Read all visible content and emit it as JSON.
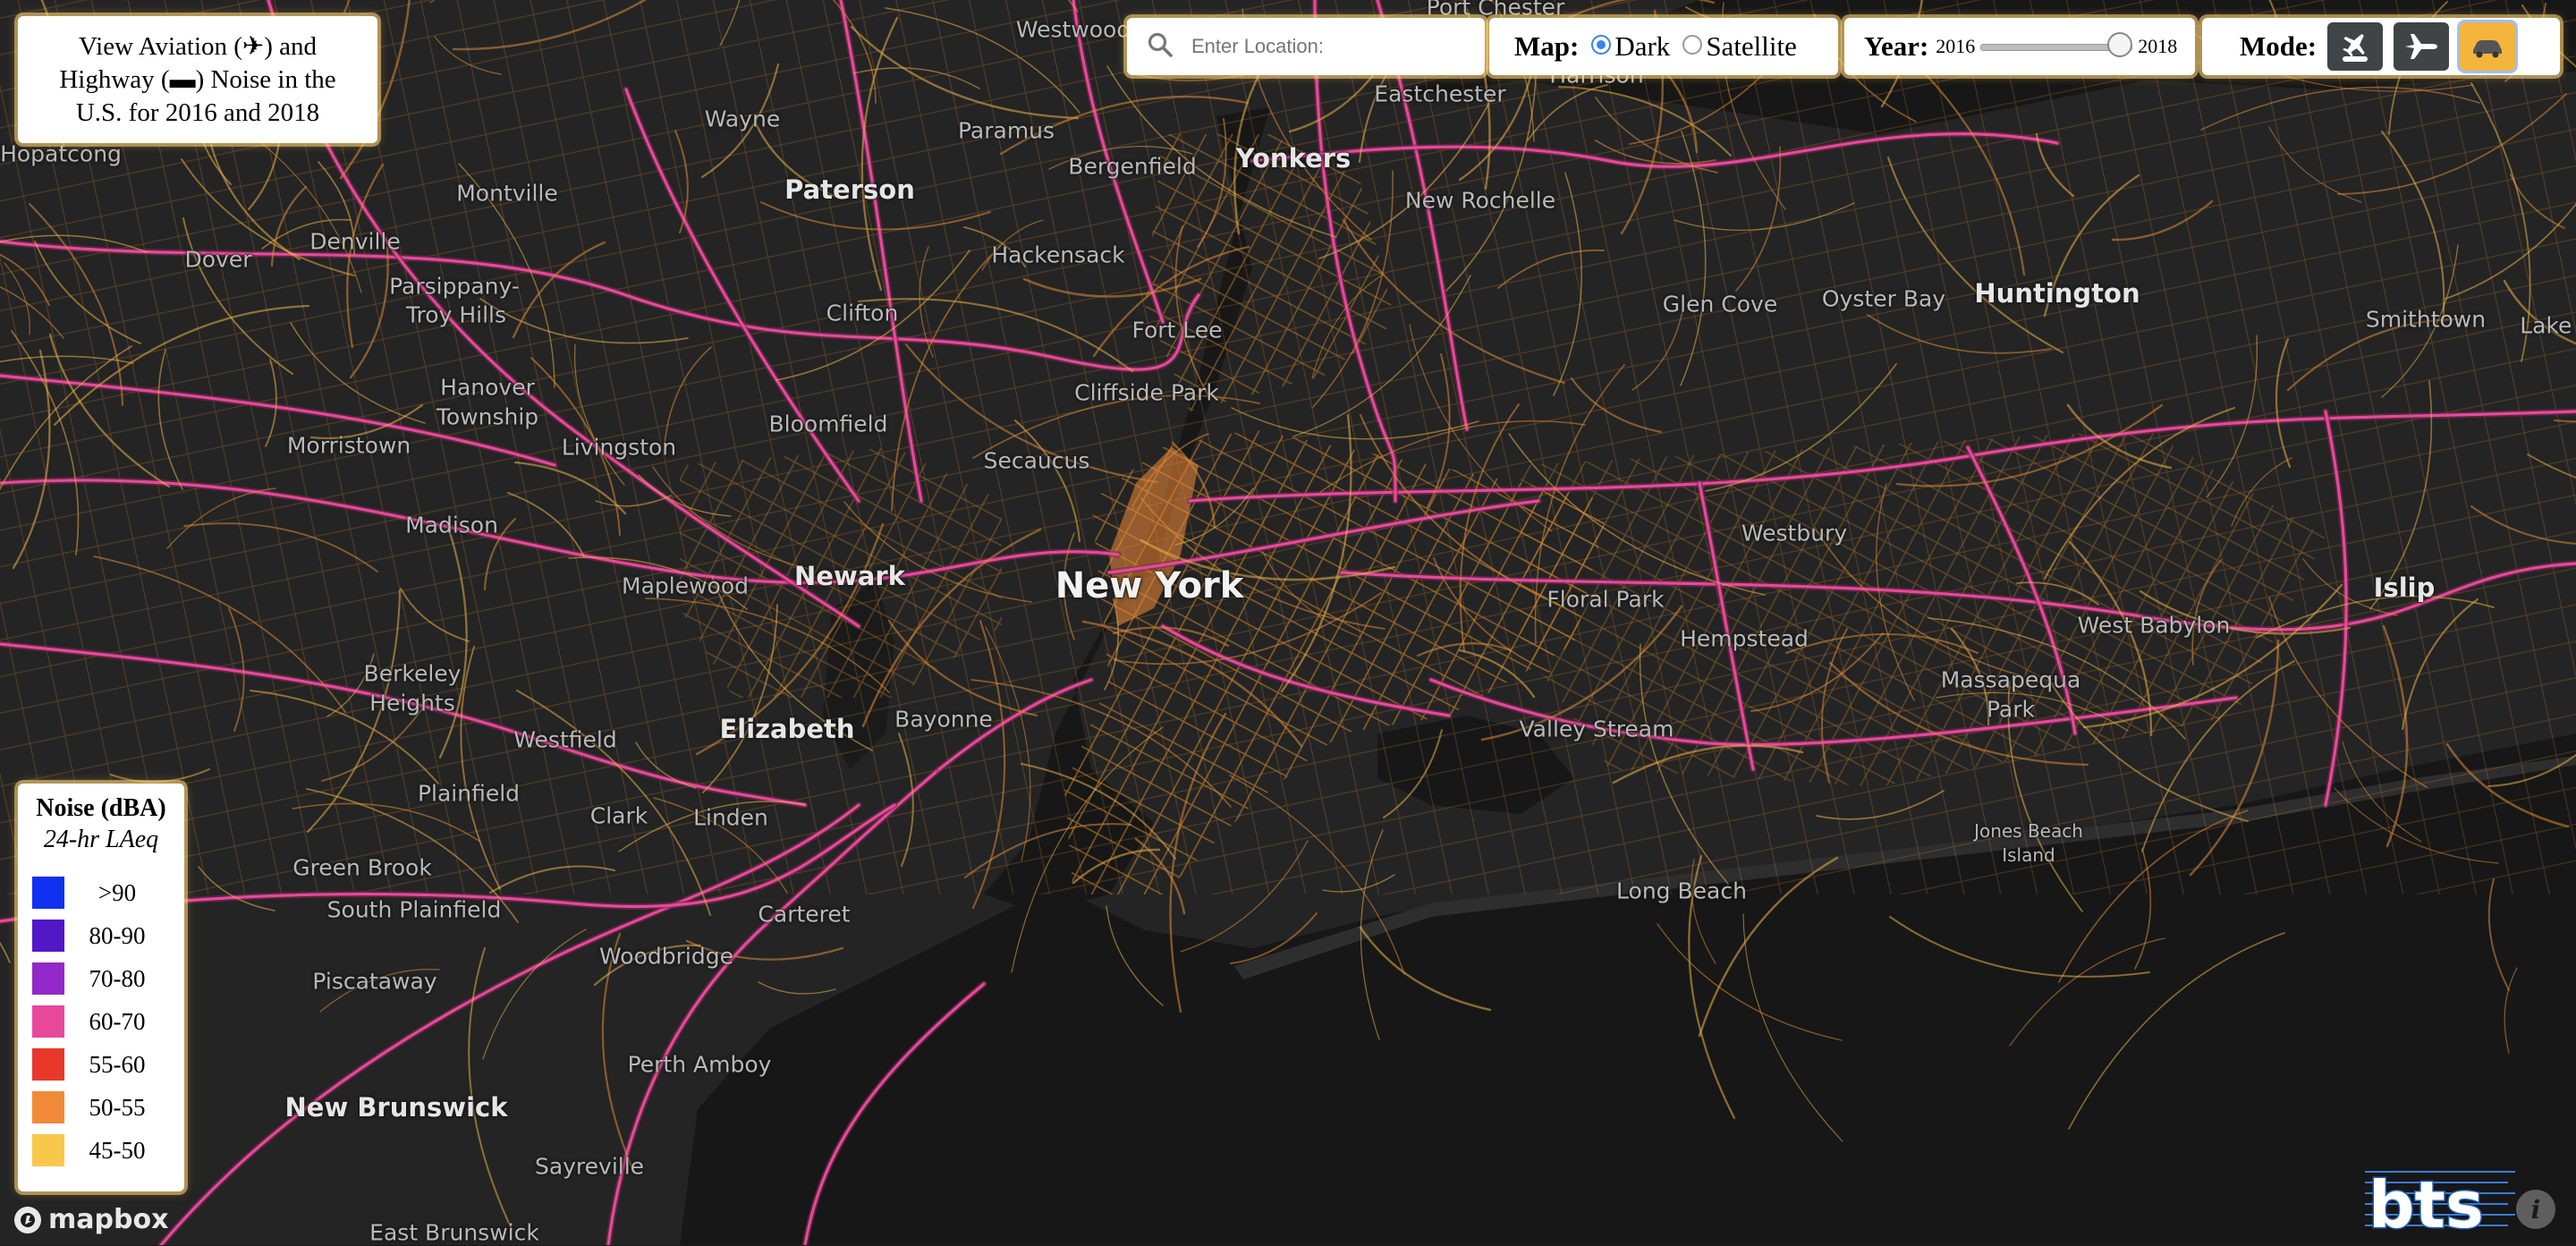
{
  "title": {
    "line1": "View Aviation (✈) and",
    "line2": "Highway (▬) Noise in the",
    "line3": "U.S. for 2016 and 2018"
  },
  "search": {
    "placeholder": "Enter Location:"
  },
  "map_toggle": {
    "label": "Map:",
    "options": [
      {
        "label": "Dark",
        "selected": true
      },
      {
        "label": "Satellite",
        "selected": false
      }
    ]
  },
  "year": {
    "label": "Year:",
    "min": "2016",
    "max": "2018",
    "value": 2018
  },
  "mode": {
    "label": "Mode:",
    "buttons": [
      {
        "icon": "plane-car-icon",
        "active": false
      },
      {
        "icon": "airplane-icon",
        "active": false
      },
      {
        "icon": "car-icon",
        "active": true
      }
    ]
  },
  "legend": {
    "title": "Noise (dBA)",
    "subtitle": "24-hr LAeq",
    "items": [
      {
        "label": ">90",
        "color": "#1030f0"
      },
      {
        "label": "80-90",
        "color": "#5218c8"
      },
      {
        "label": "70-80",
        "color": "#9228c8"
      },
      {
        "label": "60-70",
        "color": "#e8489a"
      },
      {
        "label": "55-60",
        "color": "#e8382a"
      },
      {
        "label": "50-55",
        "color": "#f08a38"
      },
      {
        "label": "45-50",
        "color": "#f8c84a"
      }
    ]
  },
  "places": [
    {
      "name": "Hopatcong",
      "type": "town"
    },
    {
      "name": "Westwood",
      "type": "town"
    },
    {
      "name": "Port Chester",
      "type": "town"
    },
    {
      "name": "Eastchester",
      "type": "town"
    },
    {
      "name": "Harrison",
      "type": "town"
    },
    {
      "name": "Wayne",
      "type": "town"
    },
    {
      "name": "Paramus",
      "type": "town"
    },
    {
      "name": "Bergenfield",
      "type": "town"
    },
    {
      "name": "Yonkers",
      "type": "city"
    },
    {
      "name": "Paterson",
      "type": "city"
    },
    {
      "name": "Montville",
      "type": "town"
    },
    {
      "name": "New Rochelle",
      "type": "town"
    },
    {
      "name": "Dover",
      "type": "town"
    },
    {
      "name": "Denville",
      "type": "town"
    },
    {
      "name": "Hackensack",
      "type": "town"
    },
    {
      "name": "Parsippany-",
      "type": "town"
    },
    {
      "name": "Troy Hills",
      "type": "town"
    },
    {
      "name": "Clifton",
      "type": "town"
    },
    {
      "name": "Glen Cove",
      "type": "town"
    },
    {
      "name": "Oyster Bay",
      "type": "town"
    },
    {
      "name": "Huntington",
      "type": "city"
    },
    {
      "name": "Smithtown",
      "type": "town"
    },
    {
      "name": "Lake G",
      "type": "town"
    },
    {
      "name": "Fort Lee",
      "type": "town"
    },
    {
      "name": "Cliffside Park",
      "type": "town"
    },
    {
      "name": "Hanover",
      "type": "town"
    },
    {
      "name": "Township",
      "type": "town"
    },
    {
      "name": "Bloomfield",
      "type": "town"
    },
    {
      "name": "Morristown",
      "type": "town"
    },
    {
      "name": "Livingston",
      "type": "town"
    },
    {
      "name": "Secaucus",
      "type": "town"
    },
    {
      "name": "Madison",
      "type": "town"
    },
    {
      "name": "Westbury",
      "type": "town"
    },
    {
      "name": "Newark",
      "type": "city"
    },
    {
      "name": "New York",
      "type": "major"
    },
    {
      "name": "Maplewood",
      "type": "town"
    },
    {
      "name": "Floral Park",
      "type": "town"
    },
    {
      "name": "Islip",
      "type": "city"
    },
    {
      "name": "Hempstead",
      "type": "town"
    },
    {
      "name": "West Babylon",
      "type": "town"
    },
    {
      "name": "Berkeley",
      "type": "town"
    },
    {
      "name": "Heights",
      "type": "town"
    },
    {
      "name": "Massapequa",
      "type": "town"
    },
    {
      "name": "Park",
      "type": "town"
    },
    {
      "name": "Bayonne",
      "type": "town"
    },
    {
      "name": "Elizabeth",
      "type": "city"
    },
    {
      "name": "Westfield",
      "type": "town"
    },
    {
      "name": "Valley Stream",
      "type": "town"
    },
    {
      "name": "Plainfield",
      "type": "town"
    },
    {
      "name": "Clark",
      "type": "town"
    },
    {
      "name": "Linden",
      "type": "town"
    },
    {
      "name": "Jones Beach",
      "type": "small"
    },
    {
      "name": "Island",
      "type": "small"
    },
    {
      "name": "Green Brook",
      "type": "town"
    },
    {
      "name": "Long Beach",
      "type": "town"
    },
    {
      "name": "Carteret",
      "type": "town"
    },
    {
      "name": "South Plainfield",
      "type": "town"
    },
    {
      "name": "Woodbridge",
      "type": "town"
    },
    {
      "name": "Piscataway",
      "type": "town"
    },
    {
      "name": "Perth Amboy",
      "type": "town"
    },
    {
      "name": "New Brunswick",
      "type": "city"
    },
    {
      "name": "Sayreville",
      "type": "town"
    },
    {
      "name": "East Brunswick",
      "type": "town"
    }
  ],
  "attribution": {
    "mapbox": "mapbox",
    "bts": "bts",
    "info": "i"
  }
}
